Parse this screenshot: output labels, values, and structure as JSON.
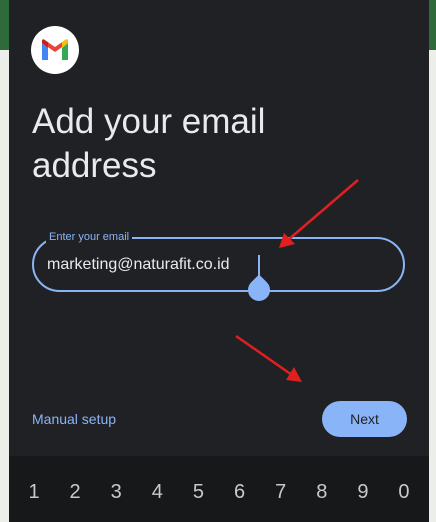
{
  "dialog": {
    "logo_icon": "gmail-logo-icon",
    "title": "Add your email address",
    "email_field": {
      "label": "Enter your email",
      "value": "marketing@naturafit.co.id"
    },
    "manual_setup_label": "Manual setup",
    "next_label": "Next"
  },
  "keyboard": {
    "keys": [
      "1",
      "2",
      "3",
      "4",
      "5",
      "6",
      "7",
      "8",
      "9",
      "0"
    ]
  },
  "colors": {
    "accent": "#8ab4f8",
    "dialog_bg": "#202124",
    "annotation_arrow": "#e02020"
  }
}
